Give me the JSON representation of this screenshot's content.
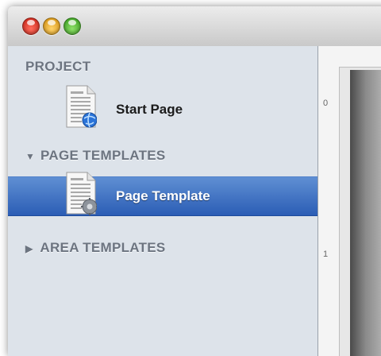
{
  "window": {
    "controls": [
      "close",
      "minimize",
      "zoom"
    ]
  },
  "sidebar": {
    "sections": [
      {
        "header": "PROJECT",
        "items": [
          {
            "label": "Start Page",
            "icon": "document-globe-icon"
          }
        ]
      },
      {
        "header": "PAGE TEMPLATES",
        "disclosure": "▼",
        "items": [
          {
            "label": "Page Template",
            "icon": "document-gear-icon",
            "selected": true
          }
        ]
      },
      {
        "header": "AREA TEMPLATES",
        "disclosure": "▶",
        "items": []
      }
    ]
  },
  "ruler": {
    "marks": [
      "0",
      "1"
    ]
  },
  "colors": {
    "sidebar_bg": "#dde3ea",
    "selection": "#2b5db5",
    "header_text": "#6c7480"
  }
}
